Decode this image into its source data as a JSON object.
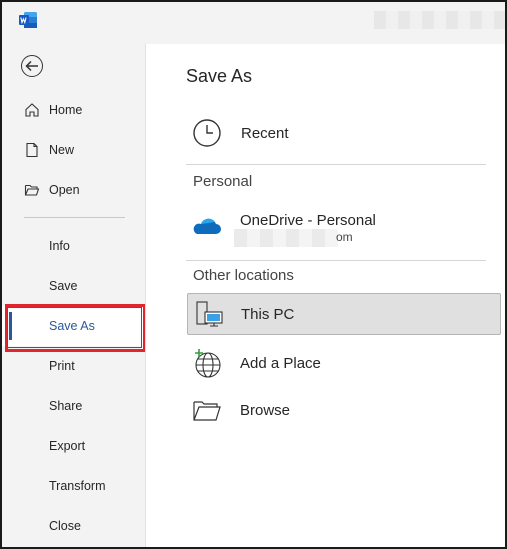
{
  "titlebar": {
    "app_icon": "word-icon",
    "user_name_blurred": ""
  },
  "nav": {
    "back_icon": "back-arrow-icon",
    "items": [
      {
        "label": "Home",
        "icon": "home-icon"
      },
      {
        "label": "New",
        "icon": "new-document-icon"
      },
      {
        "label": "Open",
        "icon": "open-folder-icon"
      },
      {
        "label": "Info"
      },
      {
        "label": "Save"
      },
      {
        "label": "Save As"
      },
      {
        "label": "Print"
      },
      {
        "label": "Share"
      },
      {
        "label": "Export"
      },
      {
        "label": "Transform"
      },
      {
        "label": "Close"
      }
    ],
    "selected": "Save As"
  },
  "main": {
    "title": "Save As",
    "recent": "Recent",
    "personal_header": "Personal",
    "onedrive_label": "OneDrive - Personal",
    "onedrive_email_suffix": "om",
    "other_header": "Other locations",
    "this_pc": "This PC",
    "add_place": "Add a Place",
    "browse": "Browse"
  },
  "colors": {
    "accent": "#2b579a",
    "highlight_box": "#e0262c",
    "onedrive": "#0f6cbd"
  }
}
